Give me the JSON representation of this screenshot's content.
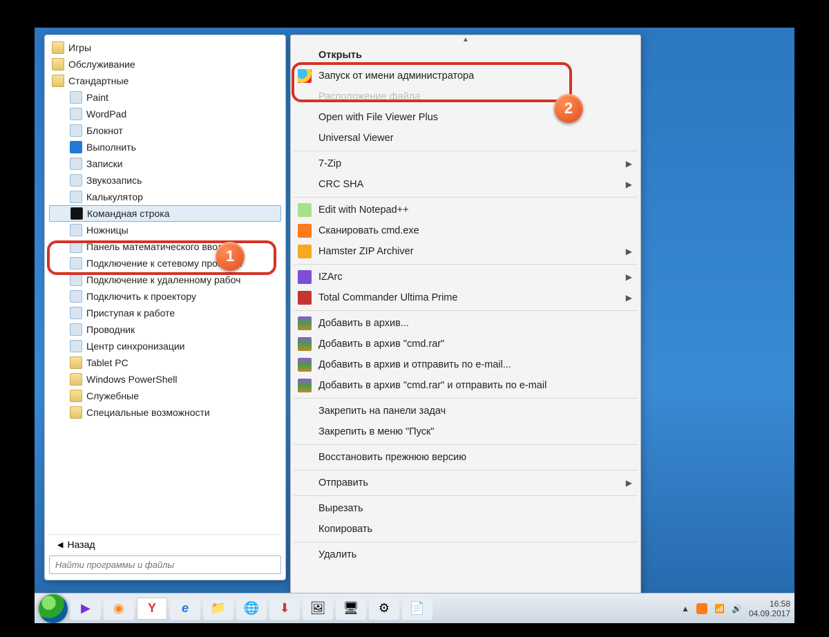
{
  "start_menu": {
    "folders_top": [
      "Игры",
      "Обслуживание",
      "Стандартные"
    ],
    "apps": [
      {
        "label": "Paint",
        "ico": "app-ico"
      },
      {
        "label": "WordPad",
        "ico": "app-ico"
      },
      {
        "label": "Блокнот",
        "ico": "app-ico"
      },
      {
        "label": "Выполнить",
        "ico": "run-ico"
      },
      {
        "label": "Записки",
        "ico": "app-ico"
      },
      {
        "label": "Звукозапись",
        "ico": "app-ico"
      },
      {
        "label": "Калькулятор",
        "ico": "app-ico"
      },
      {
        "label": "Командная строка",
        "ico": "cmd-ico",
        "highlight": true
      },
      {
        "label": "Ножницы",
        "ico": "app-ico"
      },
      {
        "label": "Панель математического ввода",
        "ico": "app-ico"
      },
      {
        "label": "Подключение к сетевому проектор",
        "ico": "app-ico"
      },
      {
        "label": "Подключение к удаленному рабоч",
        "ico": "app-ico"
      },
      {
        "label": "Подключить к проектору",
        "ico": "app-ico"
      },
      {
        "label": "Приступая к работе",
        "ico": "app-ico"
      },
      {
        "label": "Проводник",
        "ico": "app-ico"
      },
      {
        "label": "Центр синхронизации",
        "ico": "app-ico"
      }
    ],
    "folders_bottom": [
      "Tablet PC",
      "Windows PowerShell",
      "Служебные",
      "Специальные возможности"
    ],
    "back_label": "Назад",
    "search_placeholder": "Найти программы и файлы"
  },
  "context_menu": {
    "items": [
      {
        "label": "Открыть",
        "bold": true
      },
      {
        "label": "Запуск от имени администратора",
        "ico": "shield-ico",
        "highlight": true
      },
      {
        "label": "Расположение файла",
        "dim": true
      },
      {
        "label": "Open with File Viewer Plus"
      },
      {
        "label": "Universal Viewer"
      },
      {
        "sep": true
      },
      {
        "label": "7-Zip",
        "sub": true
      },
      {
        "label": "CRC SHA",
        "sub": true
      },
      {
        "sep": true
      },
      {
        "label": "Edit with Notepad++",
        "ico": "np-ico"
      },
      {
        "label": "Сканировать cmd.exe",
        "ico": "avast-ico"
      },
      {
        "label": "Hamster ZIP Archiver",
        "ico": "hamster-ico",
        "sub": true
      },
      {
        "sep": true
      },
      {
        "label": "IZArc",
        "ico": "izarc-ico",
        "sub": true
      },
      {
        "label": "Total Commander Ultima Prime",
        "ico": "tc-ico",
        "sub": true
      },
      {
        "sep": true
      },
      {
        "label": "Добавить в архив...",
        "ico": "rar-ico"
      },
      {
        "label": "Добавить в архив \"cmd.rar\"",
        "ico": "rar-ico"
      },
      {
        "label": "Добавить в архив и отправить по e-mail...",
        "ico": "rar-ico"
      },
      {
        "label": "Добавить в архив \"cmd.rar\" и отправить по e-mail",
        "ico": "rar-ico"
      },
      {
        "sep": true
      },
      {
        "label": "Закрепить на панели задач"
      },
      {
        "label": "Закрепить в меню \"Пуск\""
      },
      {
        "sep": true
      },
      {
        "label": "Восстановить прежнюю версию"
      },
      {
        "sep": true
      },
      {
        "label": "Отправить",
        "sub": true
      },
      {
        "sep": true
      },
      {
        "label": "Вырезать"
      },
      {
        "label": "Копировать"
      },
      {
        "sep": true
      },
      {
        "label": "Удалить"
      }
    ]
  },
  "badges": {
    "one": "1",
    "two": "2"
  },
  "taskbar": {
    "time": "16:58",
    "date": "04.09.2017"
  }
}
